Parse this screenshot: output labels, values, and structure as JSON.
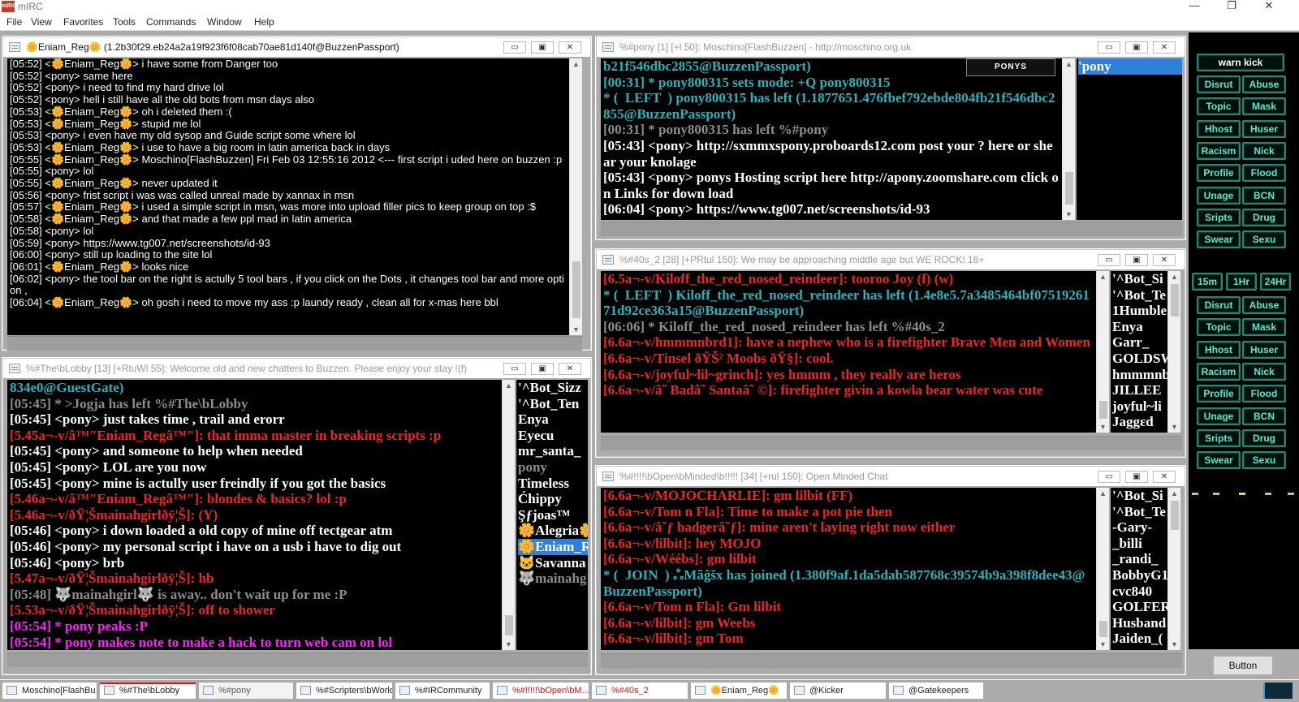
{
  "app": {
    "title": "mIRC",
    "icon_text": "mIRC"
  },
  "window_controls": {
    "minimize": "—",
    "maximize": "❐",
    "close": "✕"
  },
  "menu": [
    "File",
    "View",
    "Favorites",
    "Tools",
    "Commands",
    "Window",
    "Help"
  ],
  "mdi_buttons": {
    "min": "▭",
    "max": "▣",
    "close": "✕"
  },
  "windows": {
    "query": {
      "title": "🌼Eniam_Reg🌼  (1.2b30f29.eb24a2a19f923f6f08cab70ae81d140f@BuzzenPassport)",
      "lines": [
        {
          "t": "[05:52] <🌼Eniam_Reg🌼> i have some from Danger too"
        },
        {
          "t": "[05:52] <pony> same here"
        },
        {
          "t": "[05:52] <pony> i need to find my hard drive lol"
        },
        {
          "t": "[05:52] <pony> hell i still have all the old bots from msn days also"
        },
        {
          "t": "[05:53] <🌼Eniam_Reg🌼> oh i deleted them :("
        },
        {
          "t": "[05:53] <🌼Eniam_Reg🌼> stupid me lol"
        },
        {
          "t": "[05:53] <pony> i even have my old sysop and Guide script some where lol"
        },
        {
          "t": "[05:53] <🌼Eniam_Reg🌼> i use to have a big room in latin america back in days"
        },
        {
          "t": "[05:55] <🌼Eniam_Reg🌼> Moschino[FlashBuzzen] Fri Feb 03 12:55:16 2012 <--- first script i uded here on buzzen :p"
        },
        {
          "t": "[05:55] <pony> lol"
        },
        {
          "t": "[05:55] <🌼Eniam_Reg🌼> never updated it"
        },
        {
          "t": "[05:56] <pony> frist script i was was called unreal made by xannax in msn"
        },
        {
          "t": "[05:57] <🌼Eniam_Reg🌼> i used a simple script in msn, was more into upload filler pics to keep group on top :$"
        },
        {
          "t": "[05:58] <🌼Eniam_Reg🌼> and that made a few ppl mad in latin america"
        },
        {
          "t": "[05:58] <pony> lol"
        },
        {
          "t": "[05:59] <pony> https://www.tg007.net/screenshots/id-93"
        },
        {
          "t": "[06:00] <pony> still up loading to the site lol"
        },
        {
          "t": "[06:01] <🌼Eniam_Reg🌼> looks nice"
        },
        {
          "t": "[06:02] <pony> the tool bar on the right is actully 5 tool bars , if you click on the Dots , it changes tool bar and more option ,"
        },
        {
          "t": "[06:04] <🌼Eniam_Reg🌼> oh gosh i need to move my ass :p laundy ready , clean all for x-mas here bbl"
        }
      ]
    },
    "lobby": {
      "title": "%#The\\bLobby [13] [+RtuWl 55]: Welcome old and new chatters to Buzzen. Please enjoy your stay !(f)",
      "lines": [
        {
          "t": "834e0@GuestGate)",
          "c": "c-teal"
        },
        {
          "t": "[05:45] * >Jogja has left %#The\\bLobby",
          "c": "c-gray"
        },
        {
          "t": "[05:45] <pony> just takes time , trail and erorr"
        },
        {
          "t": "[5.45a¬-v/â™\"Eniam_Regâ™\"]: that imma master in breaking scripts :p",
          "c": "c-red"
        },
        {
          "t": "[05:45] <pony> and someone to help when needed"
        },
        {
          "t": "[05:45] <pony> LOL are you now"
        },
        {
          "t": "[05:45] <pony> mine is actully user freindly if you got the basics"
        },
        {
          "t": "[5.46a¬-v/â™\"Eniam_Regâ™\"]: blondes & basics? lol :p",
          "c": "c-red"
        },
        {
          "t": "[5.46a¬-v/ðŸ¦Šmainahgirlðÿ¦Š]: (Y)",
          "c": "c-red"
        },
        {
          "t": "[05:46] <pony> i down loaded a old copy of mine off tectgear atm"
        },
        {
          "t": "[05:46] <pony> my personal script i have on a usb i have to dig out"
        },
        {
          "t": "[05:46] <pony> brb"
        },
        {
          "t": "[5.47a¬-v/ðŸ¦Šmainahgirlðÿ¦Š]: hb",
          "c": "c-red"
        },
        {
          "t": "[05:48] 🐺mainahgirl🐺 is away.. don't wait up for me :P",
          "c": "c-gray"
        },
        {
          "t": "[5.53a¬-v/ðŸ¦Šmainahgirlðÿ¦Š]: off to shower",
          "c": "c-red"
        },
        {
          "t": "[05:54] * pony peaks :P",
          "c": "c-mag"
        },
        {
          "t": "[05:54] * pony makes note to make a hack to turn web cam on lol",
          "c": "c-mag"
        }
      ],
      "nicks": [
        {
          "n": "'^Bot_Sizz"
        },
        {
          "n": "'^Bot_Ten"
        },
        {
          "n": "Enya"
        },
        {
          "n": "Eyecu"
        },
        {
          "n": "mr_santa_"
        },
        {
          "n": "pony",
          "c": "c-gray"
        },
        {
          "n": "Timeless"
        },
        {
          "n": "Ćhippy"
        },
        {
          "n": "Şƒjoas™"
        },
        {
          "n": "🌼Alegria🌼"
        },
        {
          "n": "🌼Eniam_R",
          "sel": true
        },
        {
          "n": "🐱Savanna"
        },
        {
          "n": "🐺mainahg",
          "c": "c-gray"
        }
      ]
    },
    "pony": {
      "title": "%#pony [1] [+l 50]: Moschino[FlashBuzzen] - http://moschino.org.uk",
      "badge": "PONYS",
      "lines": [
        {
          "t": "b21f546dbc2855@BuzzenPassport)",
          "c": "c-teal"
        },
        {
          "t": "[00:31] * pony800315 sets mode: +Q pony800315",
          "c": "c-teal"
        },
        {
          "t": "* (  LEFT  ) pony800315 has left (1.1877651.476fbef792ebde804fb21f546dbc2855@BuzzenPassport)",
          "c": "c-teal",
          "tag": "LEFT"
        },
        {
          "t": "[00:31] * pony800315 has left %#pony",
          "c": "c-gray"
        },
        {
          "t": "[05:43] <pony> http://sxmmxspony.proboards12.com post your ? here or shear your knolage"
        },
        {
          "t": "[05:43] <pony> ponys Hosting script here http://apony.zoomshare.com click on Links for down load"
        },
        {
          "t": "[06:04] <pony> https://www.tg007.net/screenshots/id-93"
        }
      ],
      "nicks": [
        {
          "n": "'pony",
          "sel": true
        }
      ]
    },
    "forties": {
      "title": "%#40s_2 [28] [+PRtul 150]: We may be approaching middle age but WE ROCK! 18+",
      "lines": [
        {
          "t": "[6.5a¬-v/Kiloff_the_red_nosed_reindeer]: tooroo Joy (f) (w)",
          "c": "c-red"
        },
        {
          "t": "* (  LEFT  ) Kiloff_the_red_nosed_reindeer has left (1.4e8e5.7a3485464bf0751926171d92ce363a15@BuzzenPassport)",
          "c": "c-teal",
          "tag": "LEFT"
        },
        {
          "t": "[06:06] * Kiloff_the_red_nosed_reindeer has left %#40s_2",
          "c": "c-gray"
        },
        {
          "t": "[6.6a¬-v/hmmmnbrd1]: have a nephew who is a firefighter Brave Men and Women",
          "c": "c-red"
        },
        {
          "t": "[6.6a¬-v/Tinsel ðŸŠ² Moobs ðŸ§]: cool.",
          "c": "c-red"
        },
        {
          "t": "[6.6a¬-v/joyful~lil~grinch]: yes hmmm , they really are heros",
          "c": "c-red"
        },
        {
          "t": "[6.6a¬-v/â˜ Badâ˜ Santaâ˜ ©]: firefighter givin a kowla bear water was cute",
          "c": "c-red"
        }
      ],
      "nicks": [
        {
          "n": "'^Bot_Si"
        },
        {
          "n": "'^Bot_Te"
        },
        {
          "n": "1Humble"
        },
        {
          "n": "Enya"
        },
        {
          "n": "Garr_"
        },
        {
          "n": "GOLDSW"
        },
        {
          "n": "hmmmnb"
        },
        {
          "n": "JILLEE"
        },
        {
          "n": "joyful~li"
        },
        {
          "n": "Jaggɛd"
        }
      ]
    },
    "openminded": {
      "title": "%#!!!!\\bOpen\\bMinded\\b!!!!! [34] [+rul 150]: Open Minded Chat",
      "lines": [
        {
          "t": "[6.6a¬-v/MOJOCHARLIE]: gm lilbit (FF)",
          "c": "c-red"
        },
        {
          "t": "[6.6a¬-v/Tom n Fla]: Time to make a pot pie then",
          "c": "c-red"
        },
        {
          "t": "[6.6a¬-v/â˜ƒ badgerâ˜ƒ]: mine aren't laying right now either",
          "c": "c-red"
        },
        {
          "t": "[6.6a¬-v/lilbit]: hey MOJO",
          "c": "c-red"
        },
        {
          "t": "[6.6a¬-v/Wéébs]: gm lilbit",
          "c": "c-red"
        },
        {
          "t": "* (  JOIN  ) ஃMãĝšx has joined (1.380f9af.1da5dab587768c39574b9a398f8dee43@BuzzenPassport)",
          "c": "c-teal",
          "tag": "JOIN"
        },
        {
          "t": "[6.6a¬-v/Tom n Fla]: Gm lilbit",
          "c": "c-red"
        },
        {
          "t": "[6.6a¬-v/lilbit]: gm Weebs",
          "c": "c-red"
        },
        {
          "t": "[6.6a¬-v/lilbit]: gm Tom",
          "c": "c-red"
        }
      ],
      "nicks": [
        {
          "n": "'^Bot_Si"
        },
        {
          "n": "'^Bot_Te"
        },
        {
          "n": "-Gary-"
        },
        {
          "n": "_billi"
        },
        {
          "n": "_randi_"
        },
        {
          "n": "BobbyG1"
        },
        {
          "n": "cvc840"
        },
        {
          "n": "GOLFER1"
        },
        {
          "n": "Husband"
        },
        {
          "n": "Jaiden_("
        }
      ]
    }
  },
  "toolbar": {
    "top": "warn kick",
    "set1": [
      [
        "Disrut",
        "Abuse"
      ],
      [
        "Topic",
        "Mask"
      ],
      [
        "Hhost",
        "Huser"
      ],
      [
        "Racism",
        "Nick"
      ],
      [
        "Profile",
        "Flood"
      ],
      [
        "Unage",
        "BCN"
      ],
      [
        "Sripts",
        "Drug"
      ],
      [
        "Swear",
        "Sexu"
      ]
    ],
    "times": [
      "15m",
      "1Hr",
      "24Hr"
    ],
    "set2": [
      [
        "Disrut",
        "Abuse"
      ],
      [
        "Topic",
        "Mask"
      ],
      [
        "Hhost",
        "Huser"
      ],
      [
        "Racism",
        "Nick"
      ],
      [
        "Profile",
        "Flood"
      ],
      [
        "Unage",
        "BCN"
      ],
      [
        "Sripts",
        "Drug"
      ],
      [
        "Swear",
        "Sexu"
      ]
    ],
    "button": "Button"
  },
  "switchbar": [
    {
      "label": "Moschino[FlashBu..."
    },
    {
      "label": "%#The\\bLobby",
      "active": true
    },
    {
      "label": "%#pony",
      "dim": true
    },
    {
      "label": "%#Scripters\\bWorld"
    },
    {
      "label": "%#IRCommunity"
    },
    {
      "label": "%#!!!!!\\bOpen\\bM...",
      "alert": true
    },
    {
      "label": "%#40s_2",
      "alert": true
    },
    {
      "label": "🌼Eniam_Reg🌼"
    },
    {
      "label": "@Kicker"
    },
    {
      "label": "@Gatekeepers"
    }
  ],
  "colors": {
    "accent_teal": "#23b5bd",
    "alert_red": "#f02424",
    "action_magenta": "#ff20ff",
    "toolbar_green": "#1f8a70"
  }
}
